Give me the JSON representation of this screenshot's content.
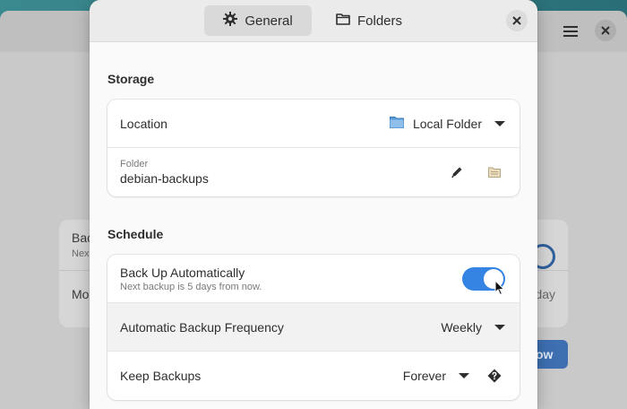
{
  "background_window": {
    "menu_icon": "hamburger-menu-icon",
    "close_icon": "close-icon",
    "card_row1_title": "Bac",
    "card_row1_subtitle": "Nex",
    "card_row2_title": "Mo",
    "card_row2_value": "day",
    "primary_button_label": "ow"
  },
  "dialog": {
    "tabs": [
      {
        "label": "General",
        "icon": "gear-icon",
        "active": true
      },
      {
        "label": "Folders",
        "icon": "folder-icon",
        "active": false
      }
    ],
    "close_icon": "close-icon",
    "storage": {
      "title": "Storage",
      "location_label": "Location",
      "location_value": "Local Folder",
      "folder_caption": "Folder",
      "folder_value": "debian-backups"
    },
    "schedule": {
      "title": "Schedule",
      "auto_label": "Back Up Automatically",
      "auto_subtitle": "Next backup is 5 days from now.",
      "auto_enabled": true,
      "frequency_label": "Automatic Backup Frequency",
      "frequency_value": "Weekly",
      "keep_label": "Keep Backups",
      "keep_value": "Forever"
    }
  },
  "colors": {
    "accent": "#3584e4",
    "dialog_bg": "#fafafa",
    "header_bg": "#ebebeb"
  }
}
